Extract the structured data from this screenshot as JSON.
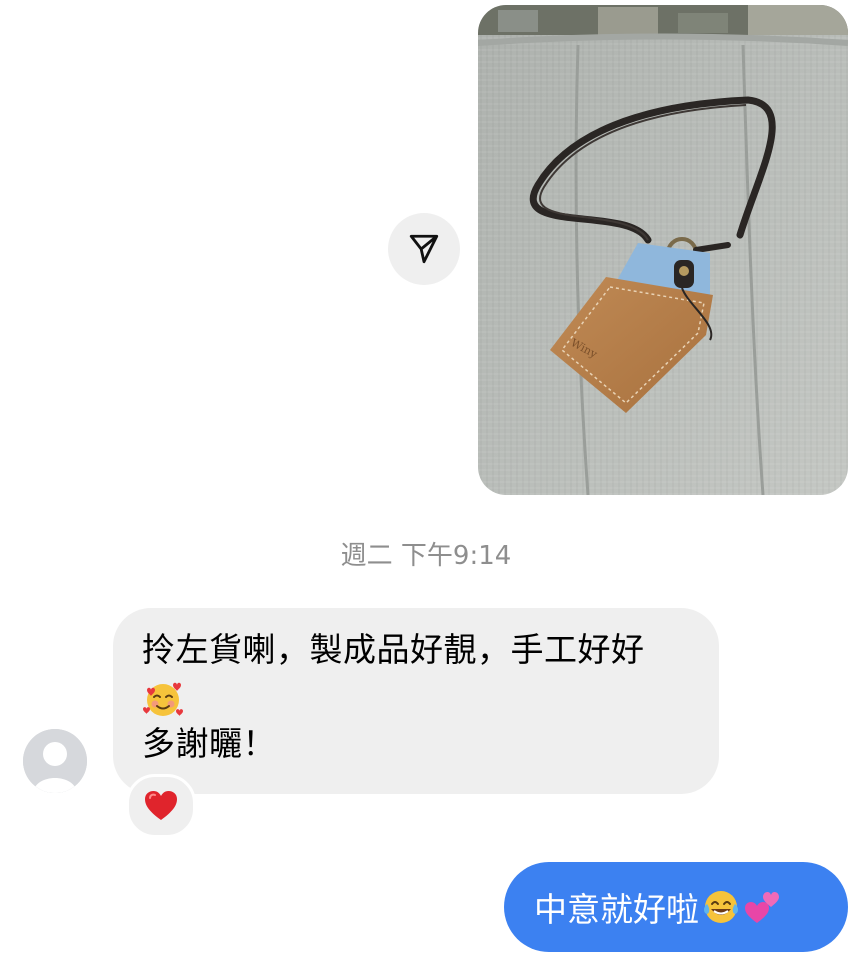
{
  "thread": {
    "timestamp": "週二 下午9:14",
    "photo": {
      "icon": "shared-photo-lanyard-card-holder"
    },
    "share_button": {
      "icon": "send-paper-plane-icon"
    },
    "received_message": {
      "line1": "拎左貨喇，製成品好靚，手工好好",
      "line3": "多謝曬！",
      "emoji": "smiling-face-with-hearts",
      "reaction": "red-heart",
      "bubble_color": "#efefef"
    },
    "sent_message": {
      "text": "中意就好啦",
      "emojis": [
        "face-with-tears-of-joy",
        "two-hearts"
      ],
      "bubble_color": "#3c81f1"
    }
  }
}
